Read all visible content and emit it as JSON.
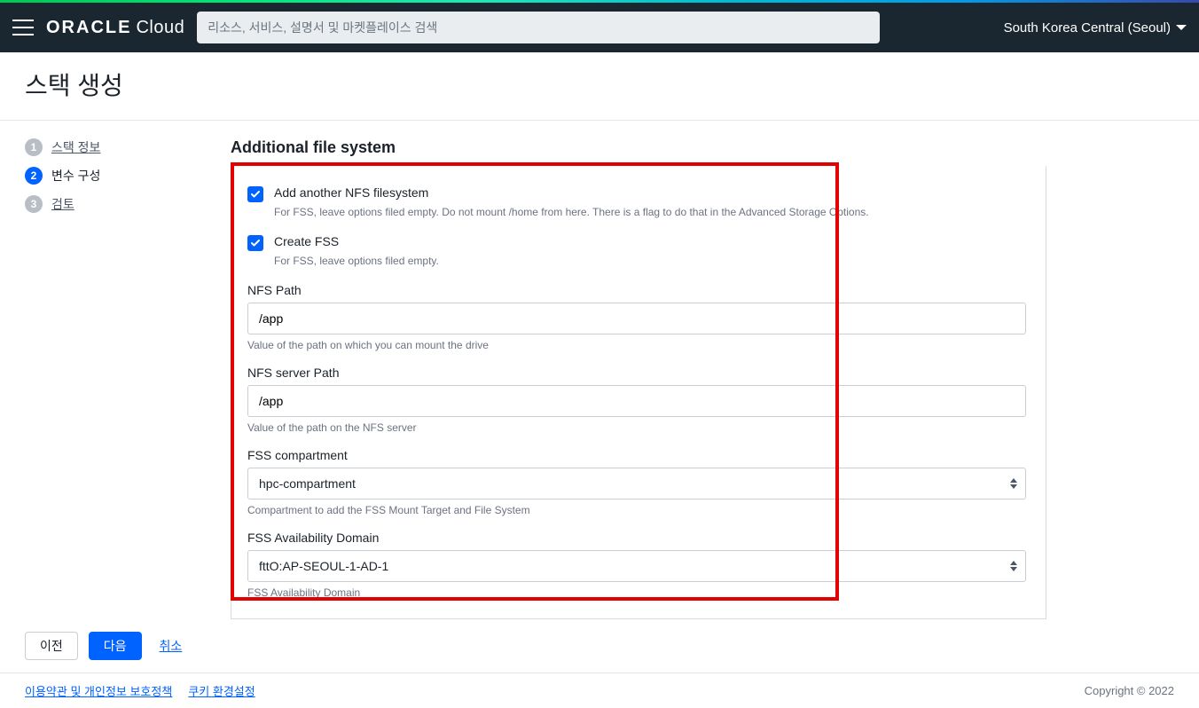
{
  "header": {
    "search_placeholder": "리소스, 서비스, 설명서 및 마켓플레이스 검색",
    "region": "South Korea Central (Seoul)",
    "logo_oracle": "ORACLE",
    "logo_cloud": "Cloud"
  },
  "page_title": "스택 생성",
  "steps": {
    "s1": {
      "num": "1",
      "label": "스택 정보"
    },
    "s2": {
      "num": "2",
      "label": "변수 구성"
    },
    "s3": {
      "num": "3",
      "label": "검토"
    }
  },
  "form": {
    "section_title": "Additional file system",
    "add_nfs": {
      "label": "Add another NFS filesystem",
      "help": "For FSS, leave options filed empty. Do not mount /home from here. There is a flag to do that in the Advanced Storage Options."
    },
    "create_fss": {
      "label": "Create FSS",
      "help": "For FSS, leave options filed empty."
    },
    "nfs_path": {
      "label": "NFS Path",
      "value": "/app",
      "help": "Value of the path on which you can mount the drive"
    },
    "nfs_server_path": {
      "label": "NFS server Path",
      "value": "/app",
      "help": "Value of the path on the NFS server"
    },
    "fss_compartment": {
      "label": "FSS compartment",
      "value": "hpc-compartment",
      "help": "Compartment to add the FSS Mount Target and File System"
    },
    "fss_ad": {
      "label": "FSS Availability Domain",
      "value": "fttO:AP-SEOUL-1-AD-1",
      "help": "FSS Availability Domain"
    }
  },
  "buttons": {
    "prev": "이전",
    "next": "다음",
    "cancel": "취소"
  },
  "footer": {
    "terms": "이용약관 및 개인정보 보호정책",
    "cookies": "쿠키 환경설정",
    "copyright": "Copyright © 2022"
  }
}
